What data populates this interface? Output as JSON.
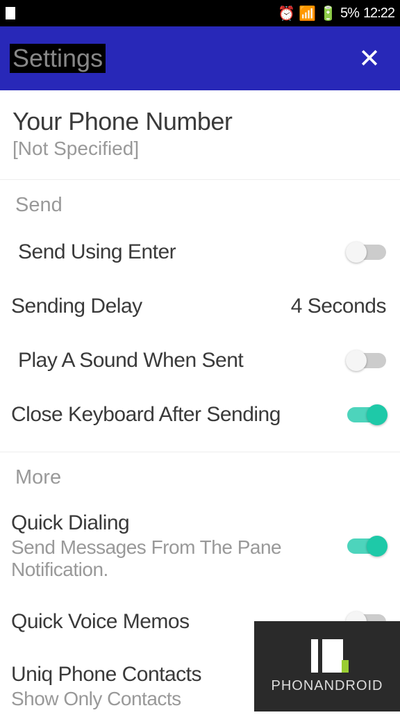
{
  "status": {
    "battery_text": "5%",
    "time": "12:22"
  },
  "header": {
    "title": "Settings"
  },
  "phone": {
    "title": "Your Phone Number",
    "value": "[Not Specified]"
  },
  "sections": {
    "send_header": "Send",
    "more_header": "More"
  },
  "settings": {
    "send_enter": {
      "label": "Send Using Enter",
      "on": false
    },
    "sending_delay": {
      "label": "Sending Delay",
      "value": "4 Seconds"
    },
    "play_sound": {
      "label": "Play A Sound When Sent",
      "on": false
    },
    "close_keyboard": {
      "label": "Close Keyboard After Sending",
      "on": true
    },
    "quick_dialing": {
      "label": "Quick Dialing",
      "sub": "Send Messages From The Pane Notification.",
      "on": true
    },
    "quick_voice": {
      "label": "Quick Voice Memos",
      "on": false
    },
    "unique_contacts": {
      "label": "Uniq Phone Contacts",
      "sub": "Show Only Contacts"
    }
  },
  "watermark": "PHONANDROID"
}
